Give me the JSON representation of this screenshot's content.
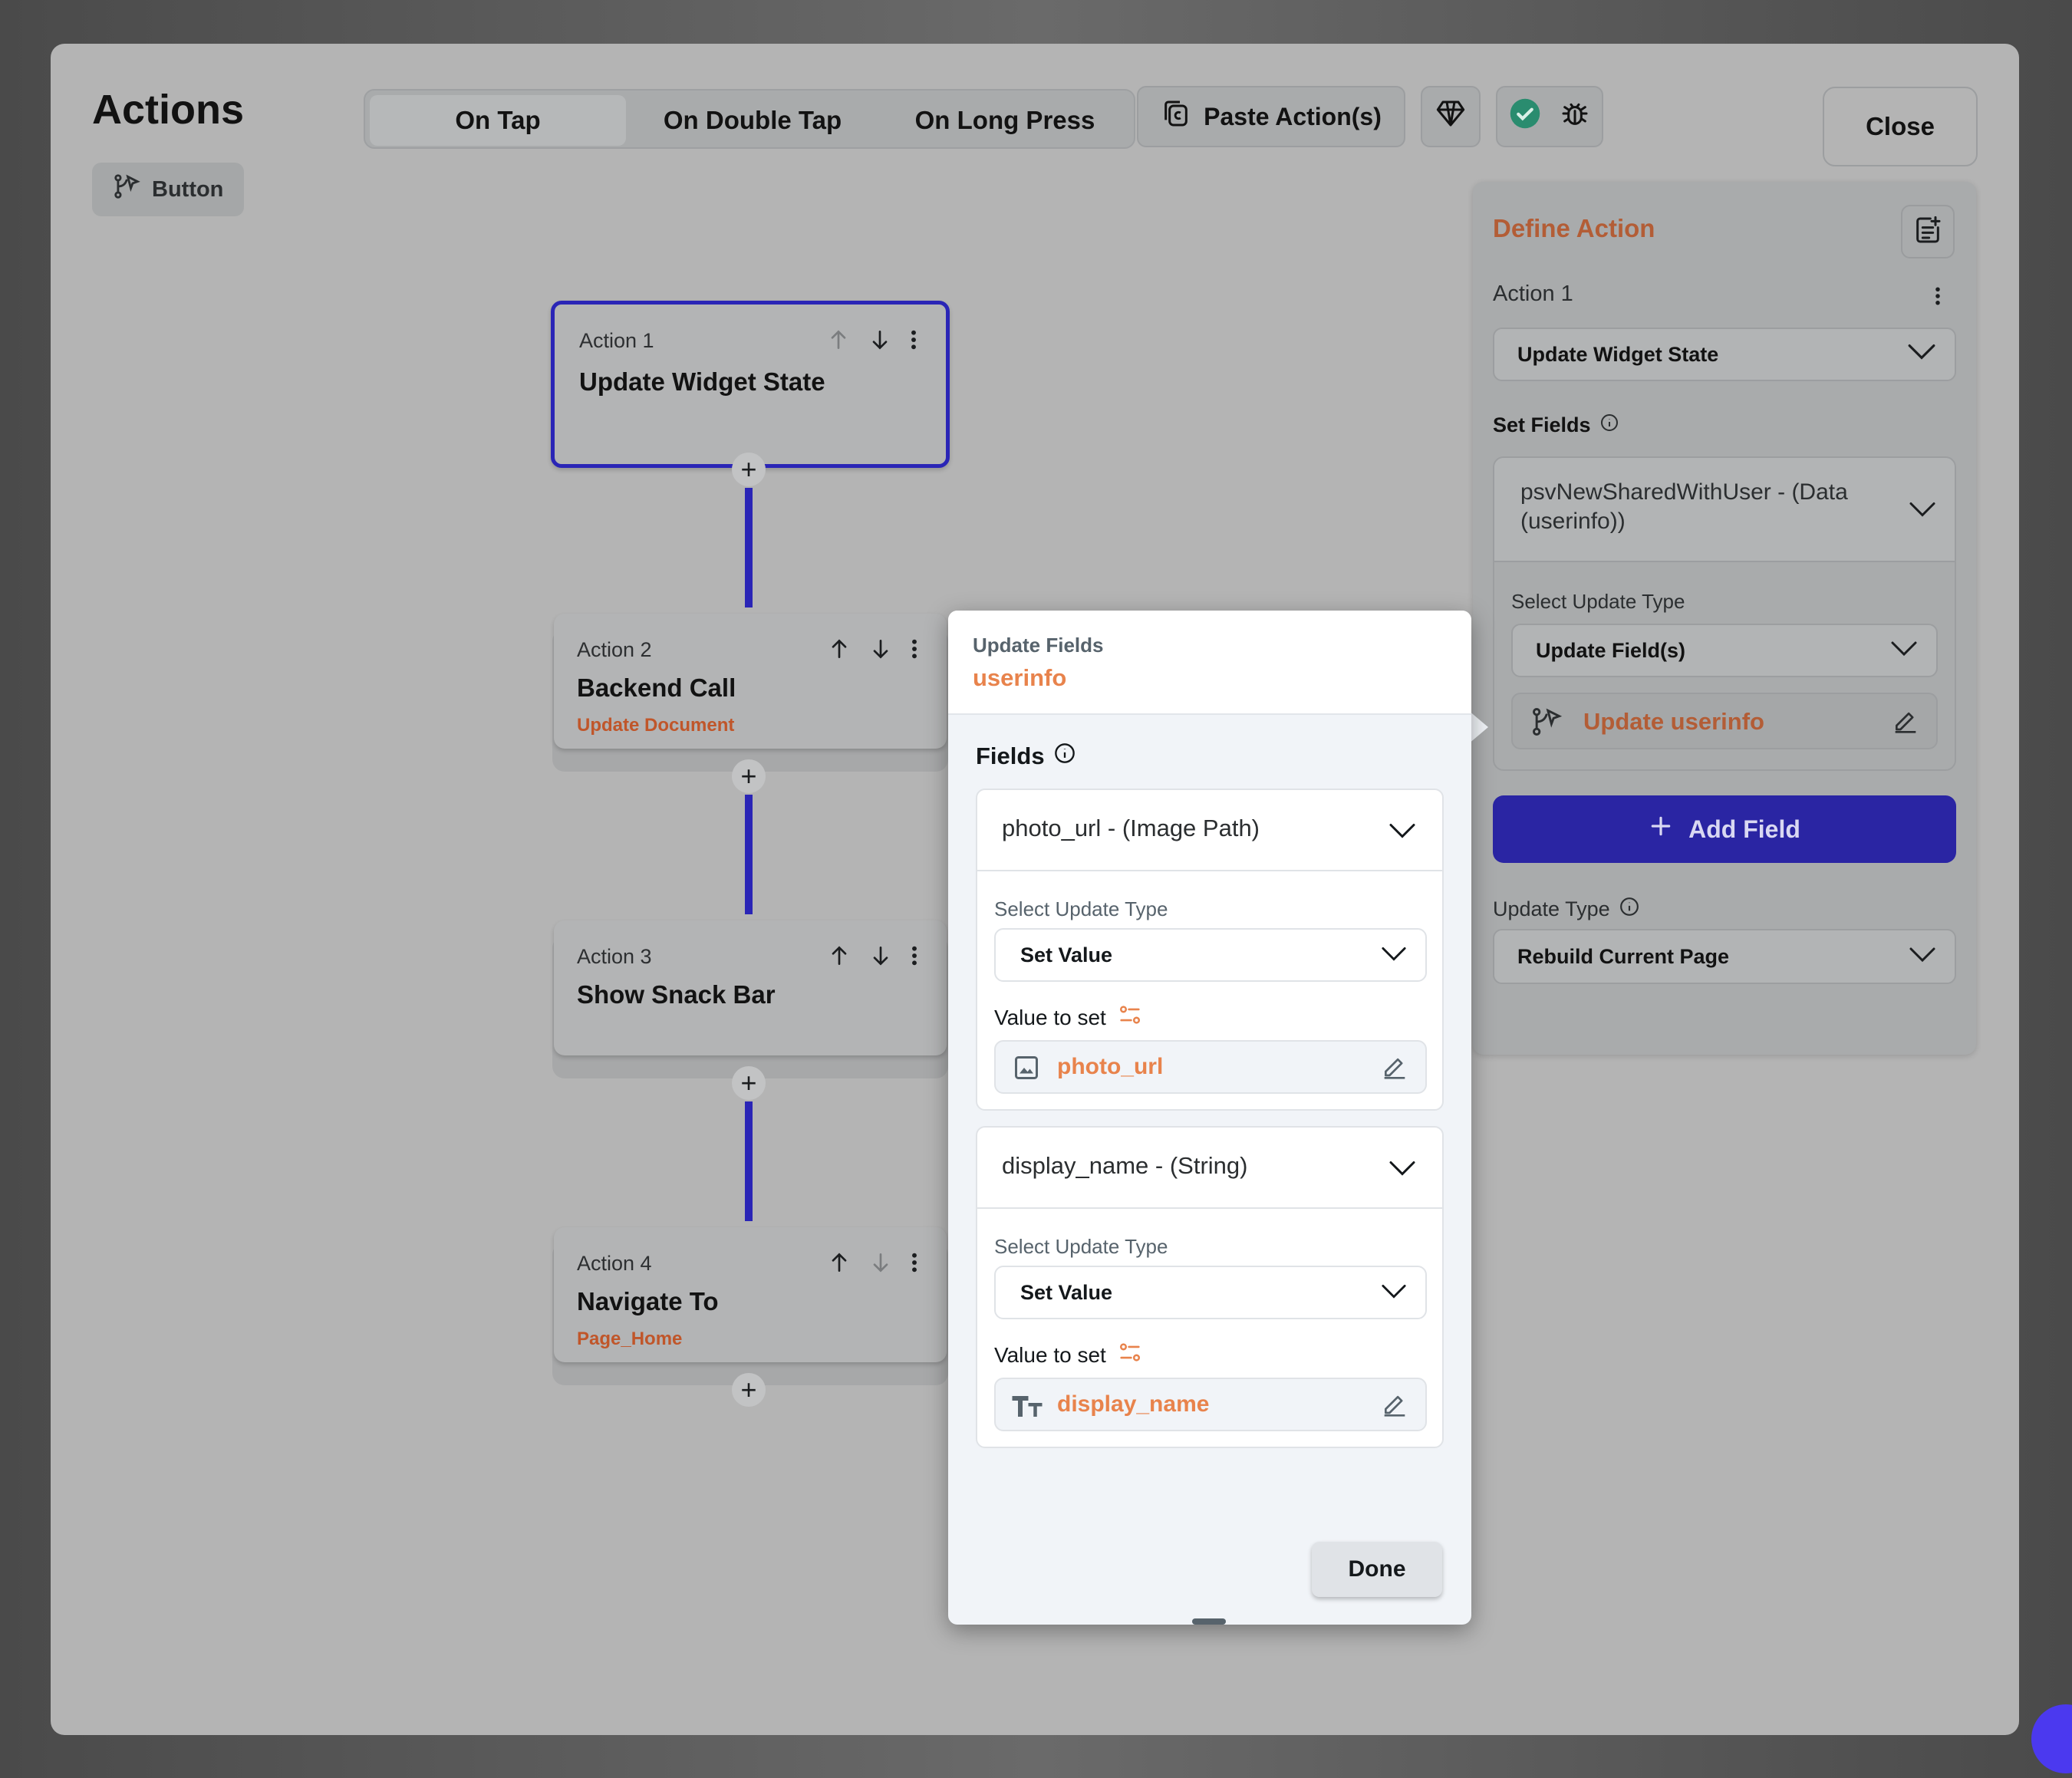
{
  "header": {
    "title": "Actions",
    "widget_chip": "Button",
    "tabs": [
      {
        "label": "On Tap",
        "active": true
      },
      {
        "label": "On Double Tap",
        "active": false
      },
      {
        "label": "On Long Press",
        "active": false
      }
    ],
    "paste_label": "Paste Action(s)",
    "close_label": "Close"
  },
  "actions": [
    {
      "label": "Action 1",
      "title": "Update Widget State",
      "subtitle": ""
    },
    {
      "label": "Action 2",
      "title": "Backend Call",
      "subtitle": "Update Document"
    },
    {
      "label": "Action 3",
      "title": "Show Snack Bar",
      "subtitle": ""
    },
    {
      "label": "Action 4",
      "title": "Navigate To",
      "subtitle": "Page_Home"
    }
  ],
  "define_panel": {
    "title": "Define Action",
    "action_label": "Action 1",
    "action_type": "Update Widget State",
    "set_fields_label": "Set Fields",
    "field_line1": "psvNewSharedWithUser - (Data",
    "field_line2": "(userinfo))",
    "select_update_type_label": "Select Update Type",
    "update_type_value": "Update Field(s)",
    "update_target": "Update userinfo",
    "add_field_label": "Add Field",
    "update_type_label": "Update Type",
    "rebuild_value": "Rebuild Current Page"
  },
  "update_popup": {
    "header_label": "Update Fields",
    "header_target": "userinfo",
    "fields_label": "Fields",
    "fields": [
      {
        "name": "photo_url - (Image Path)",
        "select_label": "Select Update Type",
        "update_type": "Set Value",
        "value_label": "Value to set",
        "value": "photo_url"
      },
      {
        "name": "display_name - (String)",
        "select_label": "Select Update Type",
        "update_type": "Set Value",
        "value_label": "Value to set",
        "value": "display_name"
      }
    ],
    "done_label": "Done"
  },
  "colors": {
    "accent_blue": "#2a25b6",
    "accent_orange": "#e8834c",
    "panel_orange": "#b35d36"
  }
}
